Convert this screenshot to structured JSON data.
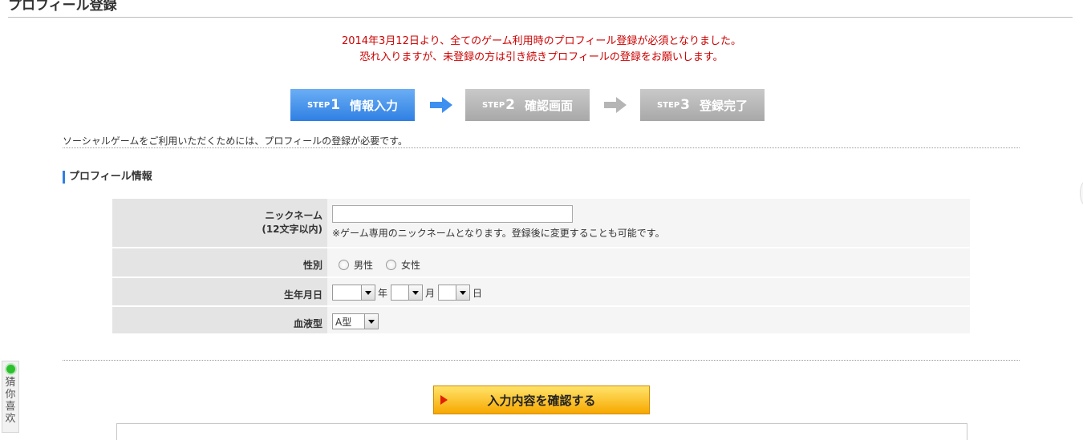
{
  "page": {
    "title": "プロフィール登録"
  },
  "notice": {
    "line1": "2014年3月12日より、全てのゲーム利用時のプロフィール登録が必須となりました。",
    "line2": "恐れ入りますが、未登録の方は引き続きプロフィールの登録をお願いします。",
    "color": "#cc0000"
  },
  "steps": [
    {
      "label": "STEP",
      "number": "1",
      "text": "情報入力",
      "state": "active"
    },
    {
      "label": "STEP",
      "number": "2",
      "text": "確認画面",
      "state": "inactive"
    },
    {
      "label": "STEP",
      "number": "3",
      "text": "登録完了",
      "state": "inactive"
    }
  ],
  "intro": "ソーシャルゲームをご利用いただくためには、プロフィールの登録が必要です。",
  "section": {
    "title": "プロフィール情報"
  },
  "form": {
    "nickname": {
      "label": "ニックネーム",
      "sub_label": "(12文字以内)",
      "value": "",
      "note": "※ゲーム専用のニックネームとなります。登録後に変更することも可能です。"
    },
    "gender": {
      "label": "性別",
      "options": [
        "男性",
        "女性"
      ]
    },
    "birthday": {
      "label": "生年月日",
      "year_value": "",
      "month_value": "",
      "day_value": "",
      "year_unit": "年",
      "month_unit": "月",
      "day_unit": "日"
    },
    "blood": {
      "label": "血液型",
      "value": "A型"
    }
  },
  "confirm_button": {
    "label": "入力内容を確認する"
  },
  "side_widget": {
    "chars": [
      "猜",
      "你",
      "喜",
      "欢"
    ]
  },
  "colors": {
    "step_active": "#2f7fe3",
    "step_inactive": "#a8a8a8",
    "button": "#f7a800",
    "section_bar": "#2f7fe3"
  }
}
